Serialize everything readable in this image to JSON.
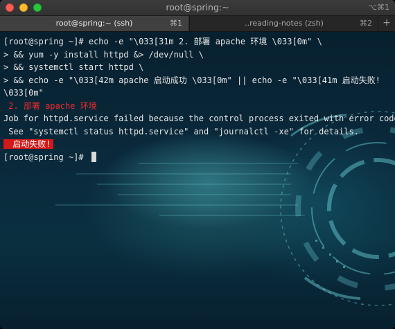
{
  "window": {
    "title": "root@spring:~",
    "shortcut": "⌥⌘1"
  },
  "tabs": [
    {
      "label": "root@spring:~ (ssh)",
      "shortcut": "⌘1",
      "active": true
    },
    {
      "label": "..reading-notes (zsh)",
      "shortcut": "⌘2",
      "active": false
    }
  ],
  "new_tab_label": "+",
  "terminal": {
    "lines": [
      "[root@spring ~]# echo -e \"\\033[31m 2. 部署 apache 环境 \\033[0m\" \\",
      "> && yum -y install httpd &> /dev/null \\",
      "> && systemctl start httpd \\",
      "> && echo -e \"\\033[42m apache 启动成功 \\033[0m\" || echo -e \"\\033[41m 启动失败!",
      "\\033[0m\"",
      " 2. 部署 apache 环境",
      "Job for httpd.service failed because the control process exited with error code.",
      " See \"systemctl status httpd.service\" and \"journalctl -xe\" for details.",
      " 启动失败!",
      "[root@spring ~]# "
    ]
  },
  "colors": {
    "error_red": "#ef2b2b",
    "error_bg": "#d21919",
    "text": "#e6e6e6"
  }
}
